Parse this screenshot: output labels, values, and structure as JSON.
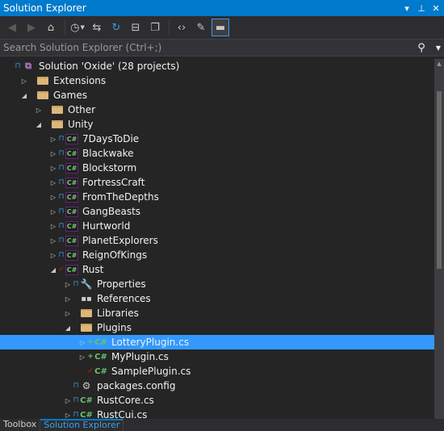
{
  "window": {
    "title": "Solution Explorer"
  },
  "toolbar": {
    "buttons": [
      {
        "name": "back-button",
        "icon": "arrow-left-icon",
        "glyph": "⬅"
      },
      {
        "name": "forward-button",
        "icon": "arrow-right-icon",
        "glyph": "➡"
      },
      {
        "name": "home-button",
        "icon": "home-icon",
        "glyph": "⌂"
      },
      {
        "name": "history-button",
        "icon": "clock-icon",
        "glyph": "◷"
      },
      {
        "name": "sync-button",
        "icon": "sync-arrows-icon",
        "glyph": "⇆"
      },
      {
        "name": "refresh-button",
        "icon": "refresh-icon",
        "glyph": "↻"
      },
      {
        "name": "collapse-all-button",
        "icon": "collapse-icon",
        "glyph": "⊟"
      },
      {
        "name": "show-all-files-button",
        "icon": "files-icon",
        "glyph": "❐"
      },
      {
        "name": "view-code-button",
        "icon": "code-brackets-icon",
        "glyph": "‹›"
      },
      {
        "name": "properties-button",
        "icon": "wrench-icon",
        "glyph": "🔧"
      },
      {
        "name": "preview-button",
        "icon": "preview-icon",
        "glyph": "▬"
      }
    ]
  },
  "search": {
    "placeholder": "Search Solution Explorer (Ctrl+;)"
  },
  "tree": [
    {
      "label": "Solution 'Oxide' (28 projects)",
      "depth": 0,
      "expander": "",
      "state": "lock",
      "icon": "sln"
    },
    {
      "label": "Extensions",
      "depth": 1,
      "expander": "collapsed",
      "state": "",
      "icon": "folder"
    },
    {
      "label": "Games",
      "depth": 1,
      "expander": "expanded",
      "state": "",
      "icon": "folder"
    },
    {
      "label": "Other",
      "depth": 2,
      "expander": "collapsed",
      "state": "",
      "icon": "folder"
    },
    {
      "label": "Unity",
      "depth": 2,
      "expander": "expanded",
      "state": "",
      "icon": "folder"
    },
    {
      "label": "7DaysToDie",
      "depth": 3,
      "expander": "collapsed",
      "state": "lock",
      "icon": "cs"
    },
    {
      "label": "Blackwake",
      "depth": 3,
      "expander": "collapsed",
      "state": "lock",
      "icon": "cs"
    },
    {
      "label": "Blockstorm",
      "depth": 3,
      "expander": "collapsed",
      "state": "lock",
      "icon": "cs"
    },
    {
      "label": "FortressCraft",
      "depth": 3,
      "expander": "collapsed",
      "state": "lock",
      "icon": "cs"
    },
    {
      "label": "FromTheDepths",
      "depth": 3,
      "expander": "collapsed",
      "state": "lock",
      "icon": "cs"
    },
    {
      "label": "GangBeasts",
      "depth": 3,
      "expander": "collapsed",
      "state": "lock",
      "icon": "cs"
    },
    {
      "label": "Hurtworld",
      "depth": 3,
      "expander": "collapsed",
      "state": "lock",
      "icon": "cs"
    },
    {
      "label": "PlanetExplorers",
      "depth": 3,
      "expander": "collapsed",
      "state": "lock",
      "icon": "cs"
    },
    {
      "label": "ReignOfKings",
      "depth": 3,
      "expander": "collapsed",
      "state": "lock",
      "icon": "cs"
    },
    {
      "label": "Rust",
      "depth": 3,
      "expander": "expanded",
      "state": "check",
      "icon": "cs"
    },
    {
      "label": "Properties",
      "depth": 4,
      "expander": "collapsed",
      "state": "lock",
      "icon": "wrench"
    },
    {
      "label": "References",
      "depth": 4,
      "expander": "collapsed",
      "state": "",
      "icon": "refs"
    },
    {
      "label": "Libraries",
      "depth": 4,
      "expander": "collapsed",
      "state": "",
      "icon": "folder"
    },
    {
      "label": "Plugins",
      "depth": 4,
      "expander": "expanded",
      "state": "",
      "icon": "folder"
    },
    {
      "label": "LotteryPlugin.cs",
      "depth": 5,
      "expander": "collapsed",
      "state": "plus",
      "icon": "csfile",
      "selected": true
    },
    {
      "label": "MyPlugin.cs",
      "depth": 5,
      "expander": "collapsed",
      "state": "plus",
      "icon": "csfile"
    },
    {
      "label": "SamplePlugin.cs",
      "depth": 5,
      "expander": "",
      "state": "check",
      "icon": "csfile"
    },
    {
      "label": "packages.config",
      "depth": 4,
      "expander": "",
      "state": "lock",
      "icon": "cfg"
    },
    {
      "label": "RustCore.cs",
      "depth": 4,
      "expander": "collapsed",
      "state": "lock",
      "icon": "csfile"
    },
    {
      "label": "RustCui.cs",
      "depth": 4,
      "expander": "collapsed",
      "state": "lock",
      "icon": "csfile"
    }
  ],
  "icons": {
    "sln": "⧉",
    "cs": "C#",
    "csfile": "C#",
    "wrench": "🔧",
    "refs": "▪▪",
    "cfg": "⚙",
    "lock": "🔒",
    "check": "✓",
    "plus": "+",
    "collapsed": "▷",
    "expanded": "◢"
  },
  "tabs": [
    {
      "label": "Toolbox",
      "active": false
    },
    {
      "label": "Solution Explorer",
      "active": true
    }
  ],
  "colors": {
    "accent": "#007acc",
    "selection": "#3399ff",
    "background": "#252526"
  }
}
